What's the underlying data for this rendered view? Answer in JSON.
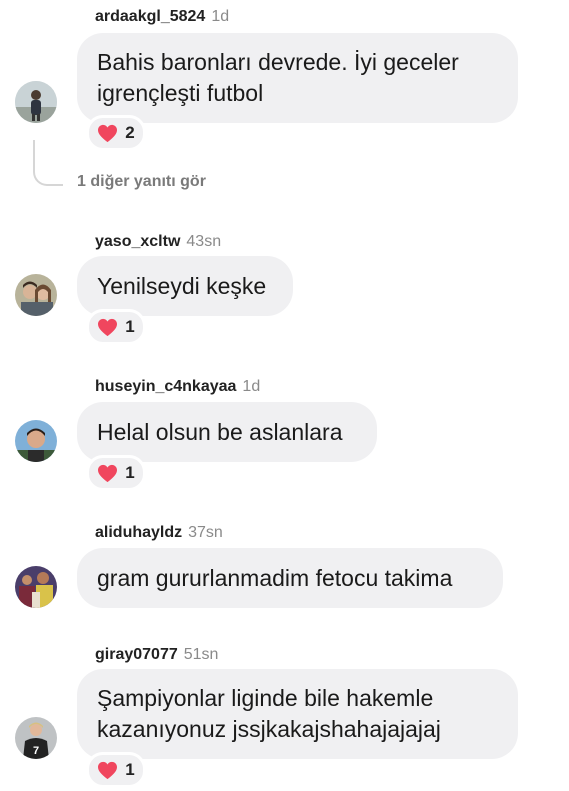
{
  "comments": [
    {
      "username": "ardaakgl_5824",
      "time": "1d",
      "lines": [
        "Bahis baronları devrede. İyi geceler",
        "igrençleşti futbol"
      ],
      "reaction_count": "2",
      "replies_link": "1 diğer yanıtı gör",
      "avatar_icon": "person-avatar-icon"
    },
    {
      "username": "yaso_xcltw",
      "time": "43sn",
      "lines": [
        "Yenilseydi keşke"
      ],
      "reaction_count": "1",
      "avatar_icon": "couple-avatar-icon"
    },
    {
      "username": "huseyin_c4nkayaa",
      "time": "1d",
      "lines": [
        "Helal olsun be aslanlara"
      ],
      "reaction_count": "1",
      "avatar_icon": "portrait-avatar-icon"
    },
    {
      "username": "aliduhayldz",
      "time": "37sn",
      "lines": [
        "gram gururlanmadim fetocu takima"
      ],
      "avatar_icon": "crowd-avatar-icon"
    },
    {
      "username": "giray07077",
      "time": "51sn",
      "lines": [
        "Şampiyonlar liginde bile hakemle",
        "kazanıyonuz jssjkakajshahajajajaj"
      ],
      "reaction_count": "1",
      "avatar_icon": "jersey-avatar-icon"
    }
  ],
  "colors": {
    "bubble": "#f0f0f2",
    "heart": "#f0465e",
    "muted_text": "#8a8a8a"
  }
}
